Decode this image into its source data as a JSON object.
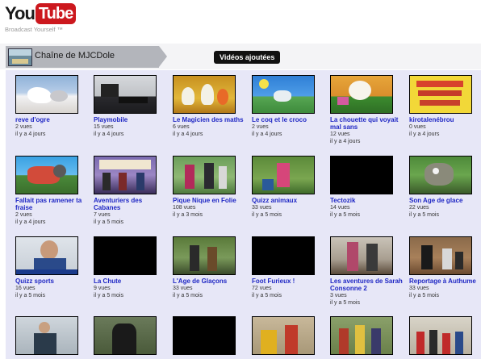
{
  "logo": {
    "you": "You",
    "tube": "Tube",
    "tagline": "Broadcast Yourself ™"
  },
  "channel": {
    "title": "Chaîne de MJCDole",
    "tab": "Vidéos ajoutées"
  },
  "videos": [
    {
      "title": "reve d'ogre",
      "views": "2 vues",
      "age": "il y a 4 jours"
    },
    {
      "title": "Playmobile",
      "views": "15 vues",
      "age": "il y a 4 jours"
    },
    {
      "title": "Le Magicien des maths",
      "views": "6 vues",
      "age": "il y a 4 jours"
    },
    {
      "title": "Le coq et le croco",
      "views": "2 vues",
      "age": "il y a 4 jours"
    },
    {
      "title": "La chouette qui voyait mal sans",
      "views": "12 vues",
      "age": "il y a 4 jours"
    },
    {
      "title": "kirotalenébrou",
      "views": "0 vues",
      "age": "il y a 4 jours"
    },
    {
      "title": "Fallait pas ramener ta fraise",
      "views": "2 vues",
      "age": "il y a 4 jours"
    },
    {
      "title": "Aventuriers des Cabanes",
      "views": "7 vues",
      "age": "il y a 5 mois"
    },
    {
      "title": "Pique Nique en Folie",
      "views": "108 vues",
      "age": "il y a 3 mois"
    },
    {
      "title": "Quizz animaux",
      "views": "33 vues",
      "age": "il y a 5 mois"
    },
    {
      "title": "Tectozik",
      "views": "14 vues",
      "age": "il y a 5 mois"
    },
    {
      "title": "Son Age de glace",
      "views": "22 vues",
      "age": "il y a 5 mois"
    },
    {
      "title": "Quizz sports",
      "views": "16 vues",
      "age": "il y a 5 mois"
    },
    {
      "title": "La Chute",
      "views": "9 vues",
      "age": "il y a 5 mois"
    },
    {
      "title": "L'Age de Glaçons",
      "views": "33 vues",
      "age": "il y a 5 mois"
    },
    {
      "title": "Foot Furieux !",
      "views": "72 vues",
      "age": "il y a 5 mois"
    },
    {
      "title": "Les aventures de Sarah Consonne 2",
      "views": "3 vues",
      "age": "il y a 5 mois"
    },
    {
      "title": "Reportage à Authume",
      "views": "33 vues",
      "age": "il y a 5 mois"
    }
  ]
}
